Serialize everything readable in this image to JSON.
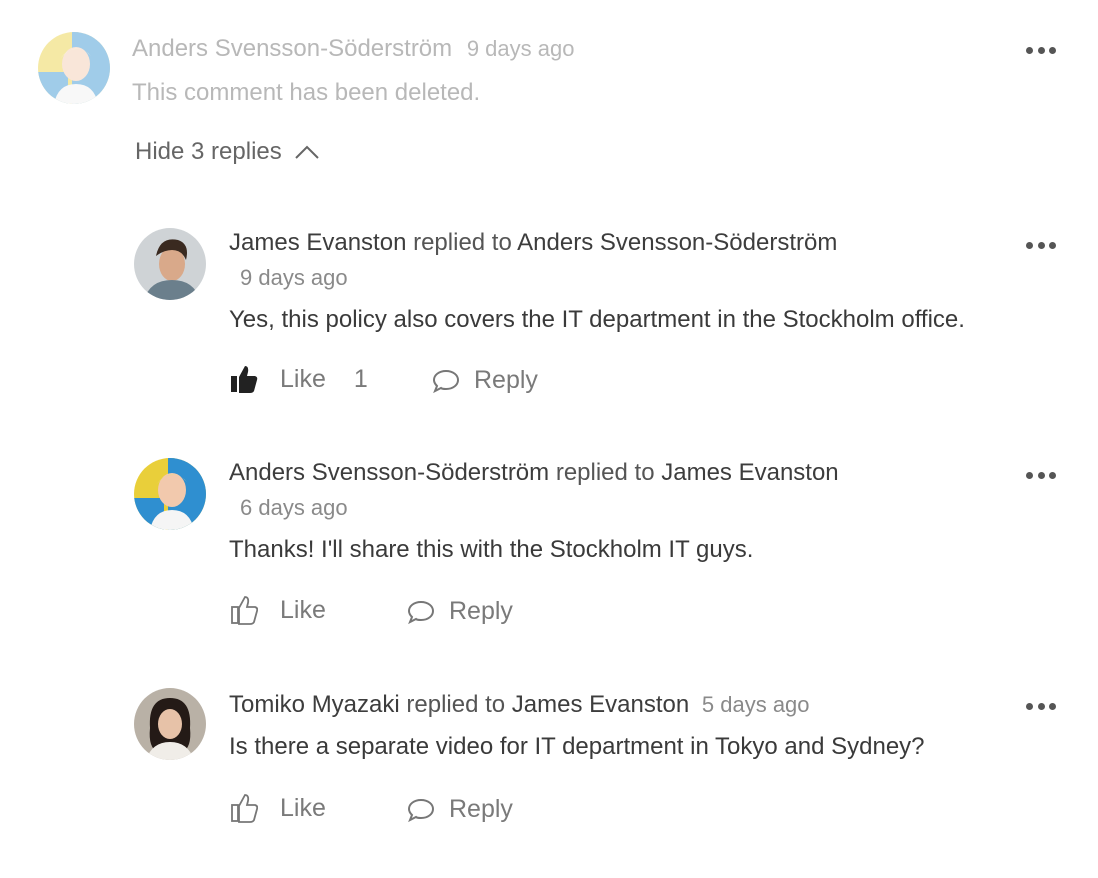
{
  "comment": {
    "author": "Anders Svensson-Söderström",
    "time": "9 days ago",
    "text": "This comment has been deleted.",
    "toggle_label": "Hide 3 replies"
  },
  "replies": [
    {
      "author": "James Evanston",
      "replied_to_label": "replied to",
      "target": "Anders Svensson-Söderström",
      "time": "9 days ago",
      "text": "Yes, this policy also covers the IT department in the Stockholm office.",
      "like_label": "Like",
      "like_count": "1",
      "liked": true,
      "reply_label": "Reply"
    },
    {
      "author": "Anders Svensson-Söderström",
      "replied_to_label": "replied to",
      "target": "James Evanston",
      "time": "6 days ago",
      "text": "Thanks! I'll share this with the Stockholm IT guys.",
      "like_label": "Like",
      "liked": false,
      "reply_label": "Reply"
    },
    {
      "author": "Tomiko Myazaki",
      "replied_to_label": "replied to",
      "target": "James Evanston",
      "time": "5 days ago",
      "text": "Is there a separate video for IT department in Tokyo and Sydney?",
      "like_label": "Like",
      "liked": false,
      "reply_label": "Reply"
    }
  ],
  "icons": {
    "more": "more-options-icon",
    "like_filled": "thumbs-up-filled-icon",
    "like_outline": "thumbs-up-outline-icon",
    "reply": "speech-bubble-icon",
    "chevron": "chevron-up-icon"
  },
  "colors": {
    "text": "#3d3d3d",
    "muted": "#8a8a8a",
    "deleted": "#b8b8b8",
    "icon": "#555555"
  }
}
